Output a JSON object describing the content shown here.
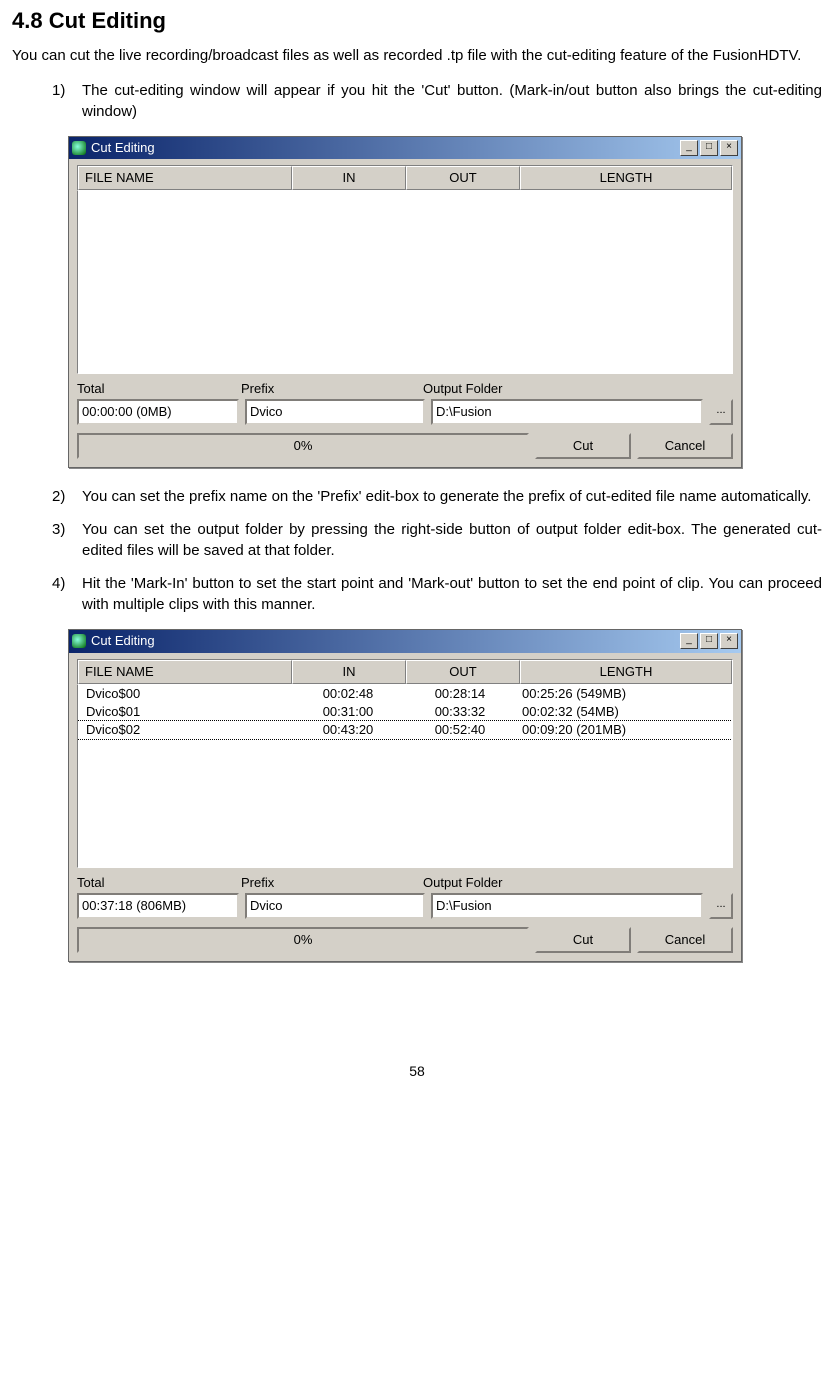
{
  "heading": "4.8    Cut Editing",
  "intro": "You can cut the live recording/broadcast files as well as recorded .tp file with the cut-editing feature of the FusionHDTV.",
  "items": [
    {
      "num": "1)",
      "text": "The cut-editing window will appear if you hit the 'Cut' button. (Mark-in/out button also brings the cut-editing window)"
    },
    {
      "num": "2)",
      "text": "You can set the prefix name on the 'Prefix' edit-box to generate the prefix of cut-edited file name automatically."
    },
    {
      "num": "3)",
      "text": "You can set the output folder by pressing the right-side button of output folder edit-box. The generated cut-edited files will be saved at that folder."
    },
    {
      "num": "4)",
      "text": "Hit the 'Mark-In' button to set the start point and 'Mark-out' button to set the end point of clip. You can proceed with multiple clips with this manner."
    }
  ],
  "win": {
    "title": "Cut Editing",
    "columns": {
      "file": "FILE NAME",
      "in": "IN",
      "out": "OUT",
      "len": "LENGTH"
    },
    "labels": {
      "total": "Total",
      "prefix": "Prefix",
      "output": "Output Folder"
    },
    "progress": "0%",
    "buttons": {
      "cut": "Cut",
      "cancel": "Cancel",
      "browse": "..."
    },
    "ctrl": {
      "min": "_",
      "max": "□",
      "close": "×"
    }
  },
  "win1": {
    "total": "00:00:00 (0MB)",
    "prefix": "Dvico",
    "output": "D:\\Fusion",
    "rows": []
  },
  "win2": {
    "total": "00:37:18 (806MB)",
    "prefix": "Dvico",
    "output": "D:\\Fusion",
    "rows": [
      {
        "file": "Dvico$00",
        "in": "00:02:48",
        "out": "00:28:14",
        "len": "00:25:26 (549MB)"
      },
      {
        "file": "Dvico$01",
        "in": "00:31:00",
        "out": "00:33:32",
        "len": "00:02:32 (54MB)"
      },
      {
        "file": "Dvico$02",
        "in": "00:43:20",
        "out": "00:52:40",
        "len": "00:09:20 (201MB)"
      }
    ]
  },
  "page": "58"
}
